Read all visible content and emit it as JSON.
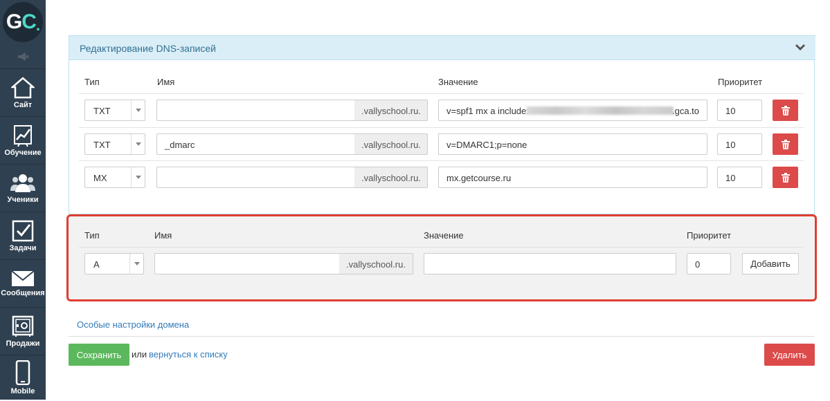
{
  "sidebar": {
    "logo_g": "G",
    "logo_c": "C",
    "logo_dot": ".",
    "items": [
      {
        "label": "Сайт",
        "icon": "home-icon"
      },
      {
        "label": "Обучение",
        "icon": "chart-icon"
      },
      {
        "label": "Ученики",
        "icon": "users-icon"
      },
      {
        "label": "Задачи",
        "icon": "checkbox-icon"
      },
      {
        "label": "Сообщения",
        "icon": "envelope-icon"
      },
      {
        "label": "Продажи",
        "icon": "safe-icon"
      },
      {
        "label": "Mobile",
        "icon": "mobile-icon"
      }
    ]
  },
  "panel": {
    "title": "Редактирование DNS-записей",
    "headers": {
      "type": "Тип",
      "name": "Имя",
      "value": "Значение",
      "priority": "Приоритет"
    },
    "rows": [
      {
        "type": "TXT",
        "name": "",
        "suffix": ".vallyschool.ru.",
        "value_prefix": "v=spf1 mx a include:",
        "value_suffix": ".gca.to",
        "priority": "10"
      },
      {
        "type": "TXT",
        "name": "_dmarc",
        "suffix": ".vallyschool.ru.",
        "value_prefix": "v=DMARC1;p=none",
        "value_suffix": "",
        "priority": "10"
      },
      {
        "type": "MX",
        "name": "",
        "suffix": ".vallyschool.ru.",
        "value_prefix": "mx.getcourse.ru",
        "value_suffix": "",
        "priority": "10"
      }
    ]
  },
  "new_record": {
    "headers": {
      "type": "Тип",
      "name": "Имя",
      "value": "Значение",
      "priority": "Приоритет"
    },
    "type": "A",
    "name": "",
    "suffix": ".vallyschool.ru.",
    "value": "",
    "priority": "0",
    "add_label": "Добавить"
  },
  "footer": {
    "special_link": "Особые настройки домена",
    "save_label": "Сохранить",
    "or_text": "или",
    "back_link": "вернуться к списку",
    "delete_label": "Удалить"
  },
  "colors": {
    "sidebar": "#2f4050",
    "panel_head": "#daeef8",
    "danger": "#dc4a4a",
    "success": "#5cb85c",
    "highlight": "#e03c31"
  }
}
